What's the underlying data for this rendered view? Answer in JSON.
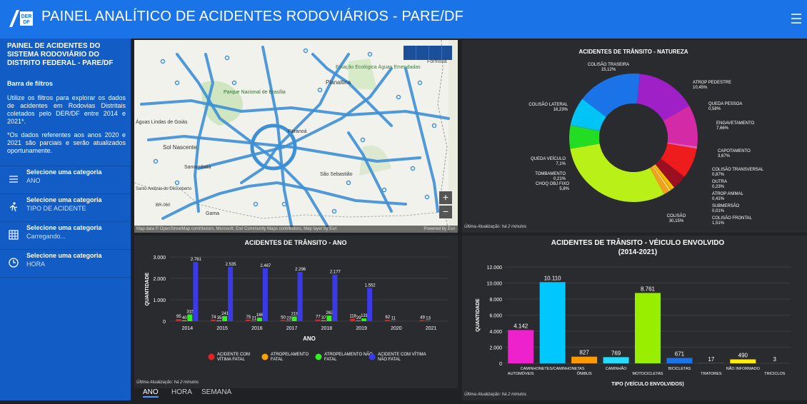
{
  "header": {
    "title": "PAINEL ANALÍTICO DE ACIDENTES RODOVIÁRIOS - PARE/DF",
    "logo_text": "DER/DF"
  },
  "sidebar": {
    "title": "PAINEL DE ACIDENTES DO SISTEMA RODOVIÁRIO DO DISTRITO FEDERAL - PARE/DF",
    "filters_heading": "Barra de filtros",
    "intro": "Utilize os filtros para explorar os dados de acidentes em Rodovias Distritais coletados pelo DER/DF entre 2014 e 2021*.",
    "note": "*Os dados referentes aos anos 2020 e 2021 são parciais e serão atualizados oportunamente.",
    "items": [
      {
        "label": "Selecione uma categoria",
        "value": "ANO",
        "icon": "list-icon"
      },
      {
        "label": "Selecione uma categoria",
        "value": "TIPO DE ACIDENTE",
        "icon": "pedestrian-icon"
      },
      {
        "label": "Selecione uma categoria",
        "value": "Carregando...",
        "icon": "grid-icon"
      },
      {
        "label": "Selecione uma categoria",
        "value": "HORA",
        "icon": "clock-icon"
      }
    ]
  },
  "map": {
    "attribution": "Map data © OpenStreetMap contributors, Microsoft, Esri Community Maps contributors, Map layer by Esri",
    "powered": "Powered by Esri",
    "labels": [
      "Parque Nacional de Brasília",
      "Formosa",
      "Estação Ecológica Águas Emendadas",
      "Planaltina",
      "Águas Lindas de Goiás",
      "Sol Nascente",
      "Samambaia",
      "Santo Antônio do Descoberto",
      "Paranoá",
      "São Sebastião",
      "BR-060",
      "Gama"
    ]
  },
  "footer_update": "Última Atualização: há 2 minutos",
  "tabs": [
    "ANO",
    "HORA",
    "SEMANA"
  ],
  "charts": {
    "pie_title": "ACIDENTES DE TRÂNSITO - NATUREZA",
    "year_title": "ACIDENTES DE TRÂNSITO - ANO",
    "vehicle_title": "ACIDENTES DE TRÂNSITO - VÉICULO ENVOLVIDO",
    "vehicle_subtitle": "(2014-2021)"
  },
  "chart_data": [
    {
      "type": "pie",
      "title": "ACIDENTES DE TRÂNSITO - NATUREZA",
      "donut": true,
      "slices": [
        {
          "label": "COLISÃO TRASEIRA",
          "pct": "15,12%",
          "value": 15.12,
          "color": "#a020c8"
        },
        {
          "label": "ATROP PEDESTRE",
          "pct": "10,45%",
          "value": 10.45,
          "color": "#d42aa8"
        },
        {
          "label": "QUEDA PESSOA",
          "pct": "0,58%",
          "value": 0.58,
          "color": "#e85ab8"
        },
        {
          "label": "ENGAVETAMENTO",
          "pct": "7,66%",
          "value": 7.66,
          "color": "#ee1c1c"
        },
        {
          "label": "CAPOTAMENTO",
          "pct": "3,67%",
          "value": 3.67,
          "color": "#9a1020"
        },
        {
          "label": "COLISÃO TRANSVERSAL",
          "pct": "0,87%",
          "value": 0.87,
          "color": "#f2c200"
        },
        {
          "label": "OUTRA",
          "pct": "0,23%",
          "value": 0.23,
          "color": "#ff8c00"
        },
        {
          "label": "ATROP ANIMAL",
          "pct": "0,41%",
          "value": 0.41,
          "color": "#ffe066"
        },
        {
          "label": "SUBMERSÃO",
          "pct": "0,01%",
          "value": 0.01,
          "color": "#cccccc"
        },
        {
          "label": "COLISÃO FRONTAL",
          "pct": "1,51%",
          "value": 1.51,
          "color": "#f0a020"
        },
        {
          "label": "COLISÃO",
          "pct": "30,15%",
          "value": 30.15,
          "color": "#b8f018"
        },
        {
          "label": "CHOQ OBJ FIXO",
          "pct": "5,8%",
          "value": 5.8,
          "color": "#22dd22"
        },
        {
          "label": "TOMBAMENTO",
          "pct": "0,21%",
          "value": 0.21,
          "color": "#2cbfa0"
        },
        {
          "label": "QUEDA VEÍCULO",
          "pct": "7,1%",
          "value": 7.1,
          "color": "#00c4f5"
        },
        {
          "label": "COLISÃO LATERAL",
          "pct": "16,23%",
          "value": 16.23,
          "color": "#1b73e8"
        }
      ]
    },
    {
      "type": "bar",
      "title": "ACIDENTES DE TRÂNSITO - ANO",
      "xlabel": "ANO",
      "ylabel": "QUANTIDADE",
      "ylim": [
        0,
        3000
      ],
      "yticks": [
        "0",
        "1.000",
        "2.000",
        "3.000"
      ],
      "categories": [
        "2014",
        "2015",
        "2016",
        "2017",
        "2018",
        "2019",
        "2020",
        "2021"
      ],
      "series": [
        {
          "name": "ACIDENTE COM VÍTIMA FATAL",
          "color": "#e52222",
          "values": [
            95,
            74,
            75,
            50,
            77,
            118,
            62,
            49
          ],
          "labels": [
            "95",
            "74",
            "75",
            "50",
            "77",
            "118",
            "62",
            "49"
          ]
        },
        {
          "name": "ATROPELAMENTO FATAL",
          "color": "#ffa000",
          "values": [
            40,
            35,
            21,
            23,
            37,
            29,
            11,
            13
          ],
          "labels": [
            "40",
            "35",
            "21",
            "23",
            "37",
            "29",
            "11",
            "13"
          ]
        },
        {
          "name": "ATROPELAMENTO NÃO FATAL",
          "color": "#33ee22",
          "values": [
            315,
            241,
            166,
            219,
            262,
            131,
            0,
            0
          ],
          "labels": [
            "315",
            "241",
            "166",
            "219",
            "262",
            "131",
            "",
            ""
          ]
        },
        {
          "name": "ACIDENTE COM VÍTIMA NÃO FATAL",
          "color": "#3a3ae8",
          "values": [
            2761,
            2535,
            2467,
            2296,
            2177,
            1552,
            0,
            0
          ],
          "labels": [
            "2.761",
            "2.535",
            "2.467",
            "2.296",
            "2.177",
            "1.552",
            "",
            ""
          ]
        }
      ]
    },
    {
      "type": "bar",
      "title": "ACIDENTES DE TRÂNSITO - VÉICULO ENVOLVIDO",
      "subtitle": "(2014-2021)",
      "xlabel": "TIPO (VEÍCULO ENVOLVIDOS)",
      "ylabel": "QUANTIDADE",
      "ylim": [
        0,
        12000
      ],
      "yticks": [
        "0",
        "2.000",
        "4.000",
        "6.000",
        "8.000",
        "10.000",
        "12.000"
      ],
      "categories": [
        "AUTOMÓVEIS",
        "CAMINHONETES/CAMINHONETAS",
        "ÔNIBUS",
        "CAMINHÃO",
        "MOTOCICLETAS",
        "BICICLETAS",
        "TRATORES",
        "NÃO INFORMADO",
        "TRICICLOS"
      ],
      "values": [
        4142,
        10110,
        827,
        769,
        8761,
        671,
        17,
        490,
        3
      ],
      "labels": [
        "4.142",
        "10.110",
        "827",
        "769",
        "8.761",
        "671",
        "17",
        "490",
        "3"
      ],
      "colors": [
        "#ee22cc",
        "#00c8ff",
        "#ff9900",
        "#22ddff",
        "#99ee00",
        "#1b73e8",
        "#888888",
        "#ffee00",
        "#aaaaaa"
      ]
    }
  ]
}
